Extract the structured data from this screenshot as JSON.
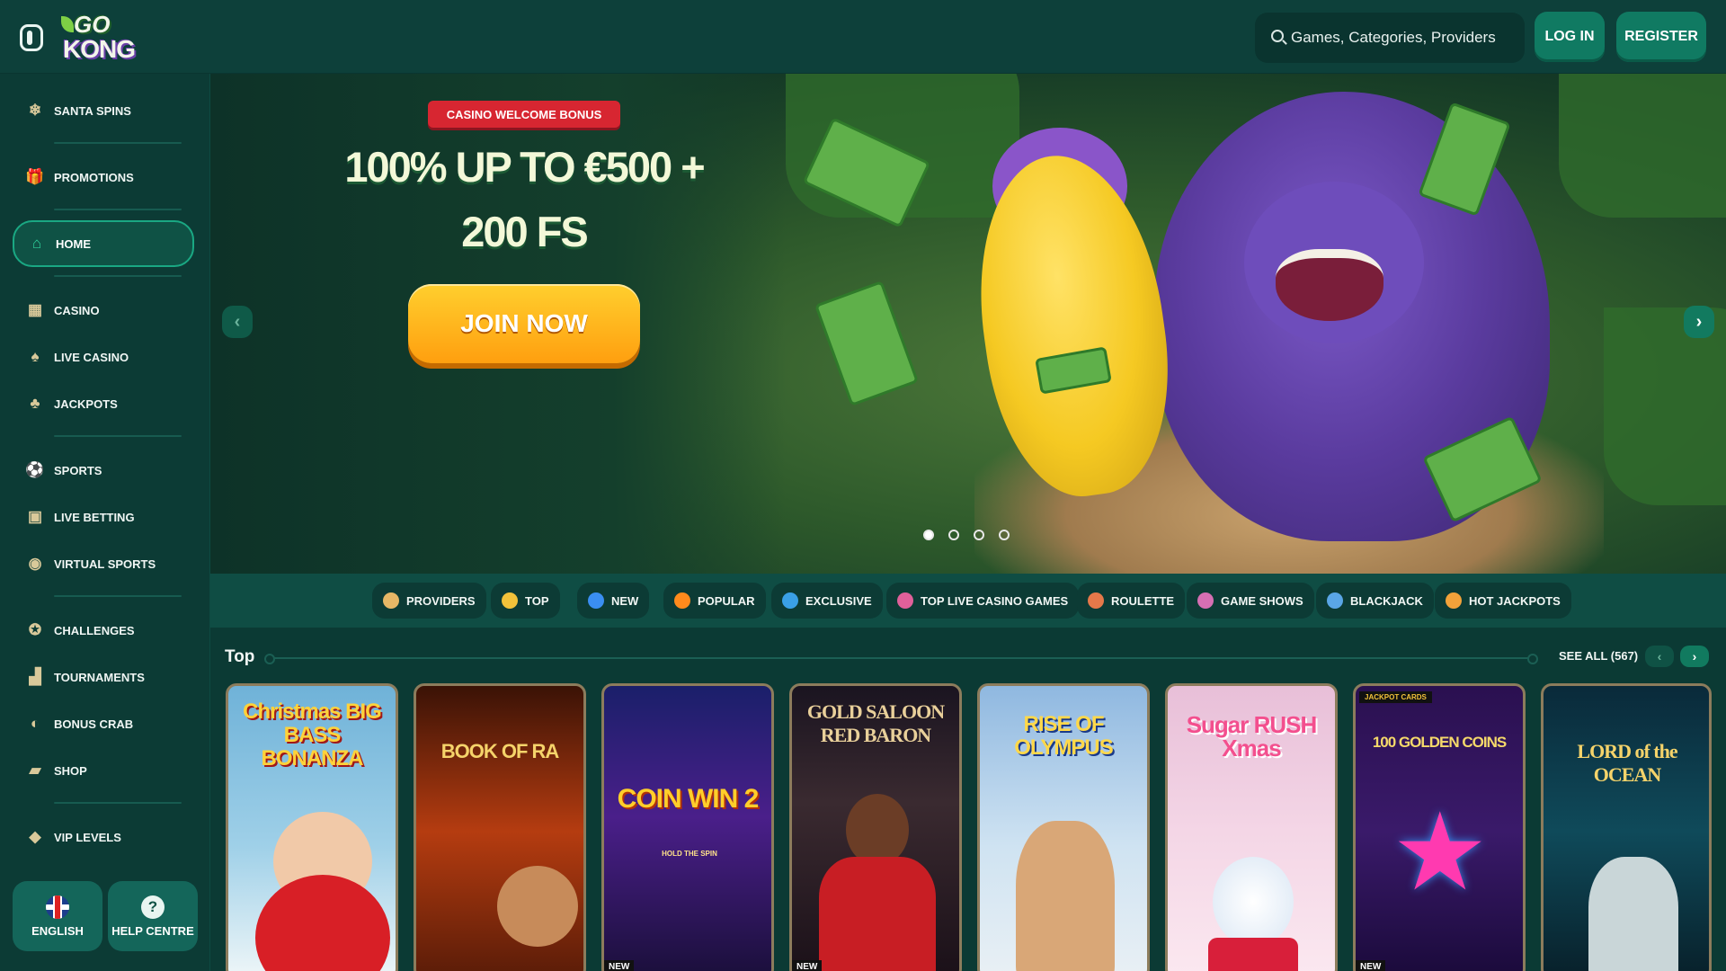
{
  "header": {
    "logo_top": "GO",
    "logo_bottom": "KONG",
    "search_placeholder": "Games, Categories, Providers",
    "login_label": "LOG IN",
    "register_label": "REGISTER"
  },
  "sidebar": {
    "items": [
      {
        "label": "SANTA SPINS",
        "icon": "snowflake-icon"
      },
      {
        "label": "PROMOTIONS",
        "icon": "gift-icon"
      },
      {
        "label": "HOME",
        "icon": "home-icon",
        "active": true
      },
      {
        "label": "CASINO",
        "icon": "slot-machine-icon"
      },
      {
        "label": "LIVE CASINO",
        "icon": "cards-icon"
      },
      {
        "label": "JACKPOTS",
        "icon": "clover-icon"
      },
      {
        "label": "SPORTS",
        "icon": "ball-icon"
      },
      {
        "label": "LIVE BETTING",
        "icon": "live-icon"
      },
      {
        "label": "VIRTUAL SPORTS",
        "icon": "virtual-icon"
      },
      {
        "label": "CHALLENGES",
        "icon": "medal-icon"
      },
      {
        "label": "TOURNAMENTS",
        "icon": "podium-icon"
      },
      {
        "label": "BONUS CRAB",
        "icon": "crab-icon"
      },
      {
        "label": "SHOP",
        "icon": "bag-icon"
      },
      {
        "label": "VIP LEVELS",
        "icon": "diamond-icon"
      }
    ],
    "language_label": "ENGLISH",
    "help_label": "HELP CENTRE"
  },
  "hero": {
    "tag": "CASINO WELCOME BONUS",
    "title": "100% UP TO €500 + 200 FS",
    "cta": "JOIN NOW",
    "slide_count": 4,
    "active_slide": 1
  },
  "categories": [
    {
      "label": "PROVIDERS",
      "color": "#e6b766"
    },
    {
      "label": "TOP",
      "color": "#f2c23a"
    },
    {
      "label": "NEW",
      "color": "#3a8ef2"
    },
    {
      "label": "POPULAR",
      "color": "#ff8a1c"
    },
    {
      "label": "EXCLUSIVE",
      "color": "#3aa0e6"
    },
    {
      "label": "TOP LIVE CASINO GAMES",
      "color": "#e0609a"
    },
    {
      "label": "ROULETTE",
      "color": "#e6784a"
    },
    {
      "label": "GAME SHOWS",
      "color": "#d66fb3"
    },
    {
      "label": "BLACKJACK",
      "color": "#5aa6e6"
    },
    {
      "label": "HOT JACKPOTS",
      "color": "#f2a23a"
    }
  ],
  "section": {
    "title": "Top",
    "see_all": "SEE ALL (567)"
  },
  "games": [
    {
      "title": "Christmas BIG BASS BONANZA",
      "new": false
    },
    {
      "title": "BOOK OF RA",
      "new": false
    },
    {
      "title": "COIN WIN 2",
      "subtitle": "HOLD THE SPIN",
      "new": true,
      "new_label": "NEW"
    },
    {
      "title": "GOLD SALOON RED BARON",
      "new": true,
      "new_label": "NEW"
    },
    {
      "title": "RISE OF OLYMPUS",
      "new": false
    },
    {
      "title": "Sugar RUSH Xmas",
      "new": false
    },
    {
      "title": "100 GOLDEN COINS",
      "badge": "JACKPOT CARDS",
      "new": true,
      "new_label": "NEW"
    },
    {
      "title": "LORD of the OCEAN",
      "new": false
    }
  ]
}
